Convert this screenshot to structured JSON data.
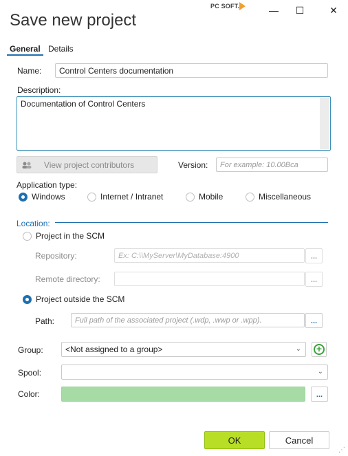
{
  "window": {
    "title": "Save new project",
    "brand": "PC SOFT.",
    "minimize_glyph": "—",
    "maximize_glyph": "☐",
    "close_glyph": "✕"
  },
  "tabs": [
    {
      "label": "General",
      "active": true
    },
    {
      "label": "Details",
      "active": false
    }
  ],
  "form": {
    "name_label": "Name:",
    "name_value": "Control Centers documentation",
    "description_label": "Description:",
    "description_value": "Documentation of Control Centers",
    "contributors_button": "View project contributors",
    "version_label": "Version:",
    "version_placeholder": "For example: 10.00Bca",
    "app_type_label": "Application type:",
    "app_types": [
      {
        "label": "Windows",
        "selected": true
      },
      {
        "label": "Internet / Intranet",
        "selected": false
      },
      {
        "label": "Mobile",
        "selected": false
      },
      {
        "label": "Miscellaneous",
        "selected": false
      }
    ],
    "location_label": "Location:",
    "scm_option": "Project in the SCM",
    "repository_label": "Repository:",
    "repository_placeholder": "Ex: C:\\\\MyServer\\MyDatabase:4900",
    "remote_dir_label": "Remote directory:",
    "outside_scm_option": "Project outside the SCM",
    "path_label": "Path:",
    "path_placeholder": "Full path of the associated project (.wdp, .wwp or .wpp).",
    "browse_glyph": "...",
    "group_label": "Group:",
    "group_value": "<Not assigned to a group>",
    "spool_label": "Spool:",
    "spool_value": "",
    "color_label": "Color:",
    "color_value": "#a6dba6"
  },
  "buttons": {
    "ok": "OK",
    "cancel": "Cancel"
  },
  "colors": {
    "accent": "#1e6fb0",
    "ok_button": "#b8df26",
    "add_group": "#3aa23a"
  }
}
